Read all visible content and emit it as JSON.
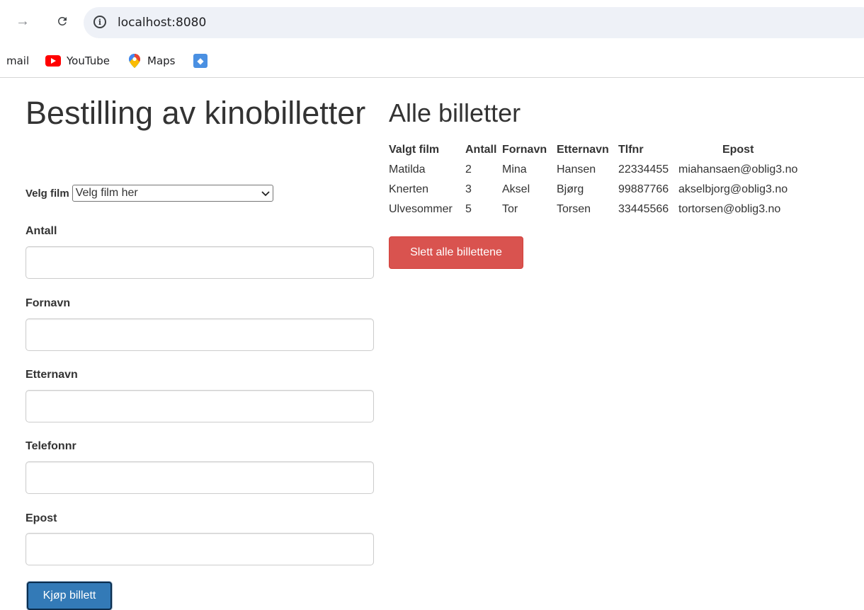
{
  "browser": {
    "url": "localhost:8080",
    "bookmarks": [
      {
        "label": "mail",
        "icon": "none"
      },
      {
        "label": "YouTube",
        "icon": "youtube-icon"
      },
      {
        "label": "Maps",
        "icon": "maps-pin-icon"
      },
      {
        "label": "",
        "icon": "drop-icon"
      }
    ]
  },
  "order_form": {
    "title": "Bestilling av kinobilletter",
    "film_label": "Velg film",
    "film_select_value": "Velg film her",
    "fields": {
      "antall": {
        "label": "Antall",
        "value": ""
      },
      "fornavn": {
        "label": "Fornavn",
        "value": ""
      },
      "etternavn": {
        "label": "Etternavn",
        "value": ""
      },
      "telefonnr": {
        "label": "Telefonnr",
        "value": ""
      },
      "epost": {
        "label": "Epost",
        "value": ""
      }
    },
    "buy_label": "Kjøp billett"
  },
  "tickets": {
    "title": "Alle billetter",
    "headers": [
      "Valgt film",
      "Antall",
      "Fornavn",
      "Etternavn",
      "Tlfnr",
      "Epost"
    ],
    "rows": [
      [
        "Matilda",
        "2",
        "Mina",
        "Hansen",
        "22334455",
        "miahansaen@oblig3.no"
      ],
      [
        "Knerten",
        "3",
        "Aksel",
        "Bjørg",
        "99887766",
        "akselbjorg@oblig3.no"
      ],
      [
        "Ulvesommer",
        "5",
        "Tor",
        "Torsen",
        "33445566",
        "tortorsen@oblig3.no"
      ]
    ],
    "delete_label": "Slett alle billettene"
  },
  "colors": {
    "primary": "#337ab7",
    "danger": "#d9534f",
    "text": "#333333"
  }
}
